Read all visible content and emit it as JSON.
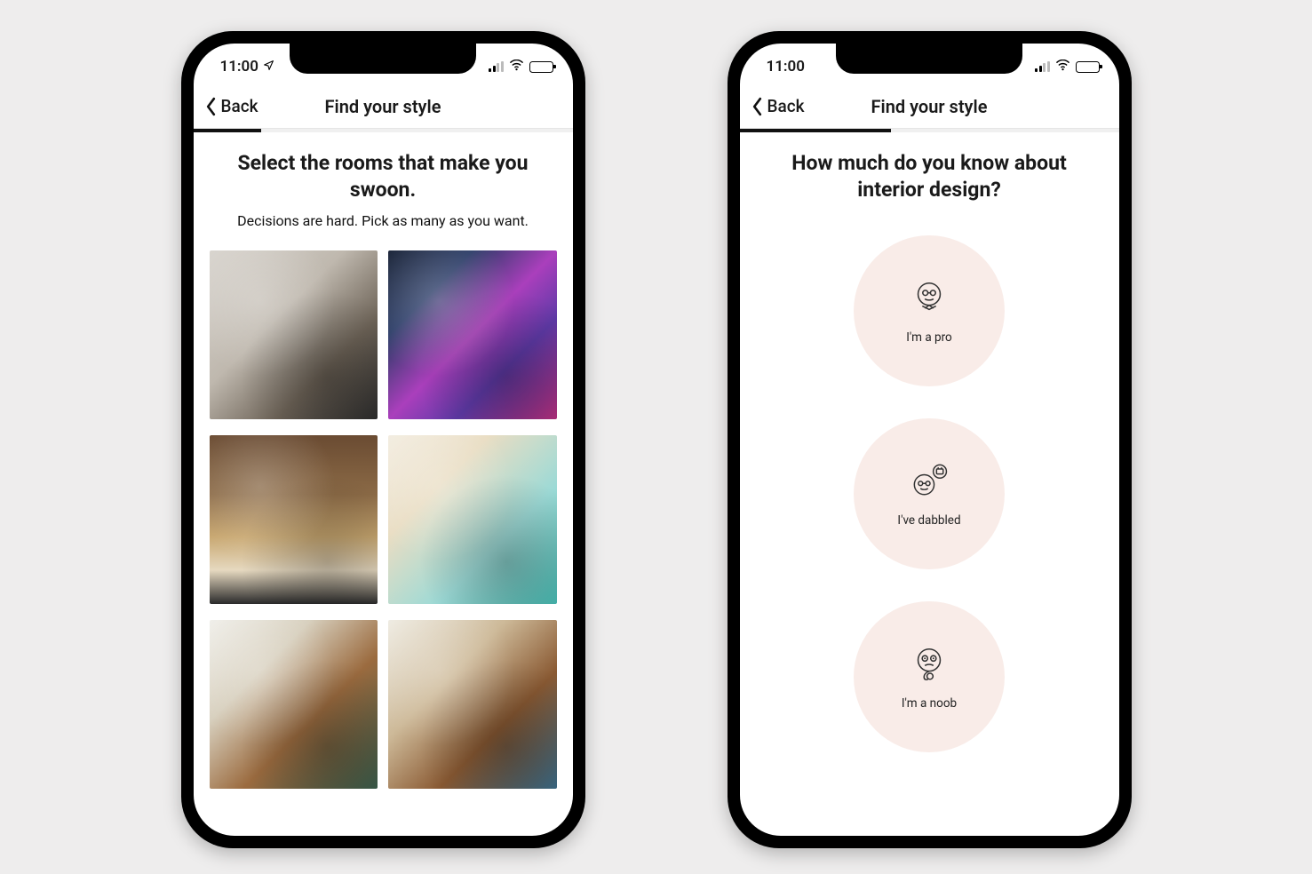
{
  "status": {
    "time": "11:00"
  },
  "nav": {
    "back_label": "Back",
    "title": "Find your style"
  },
  "screen1": {
    "headline": "Select the rooms that make you swoon.",
    "subhead": "Decisions are hard. Pick as many as you want.",
    "rooms": [
      {
        "name": "room-1"
      },
      {
        "name": "room-2"
      },
      {
        "name": "room-3"
      },
      {
        "name": "room-4"
      },
      {
        "name": "room-5"
      },
      {
        "name": "room-6"
      }
    ]
  },
  "screen2": {
    "headline": "How much do you know about interior design?",
    "options": [
      {
        "label": "I'm a pro",
        "icon": "pro-face-icon"
      },
      {
        "label": "I've dabbled",
        "icon": "dabbled-face-icon"
      },
      {
        "label": "I'm a noob",
        "icon": "noob-face-icon"
      }
    ]
  }
}
